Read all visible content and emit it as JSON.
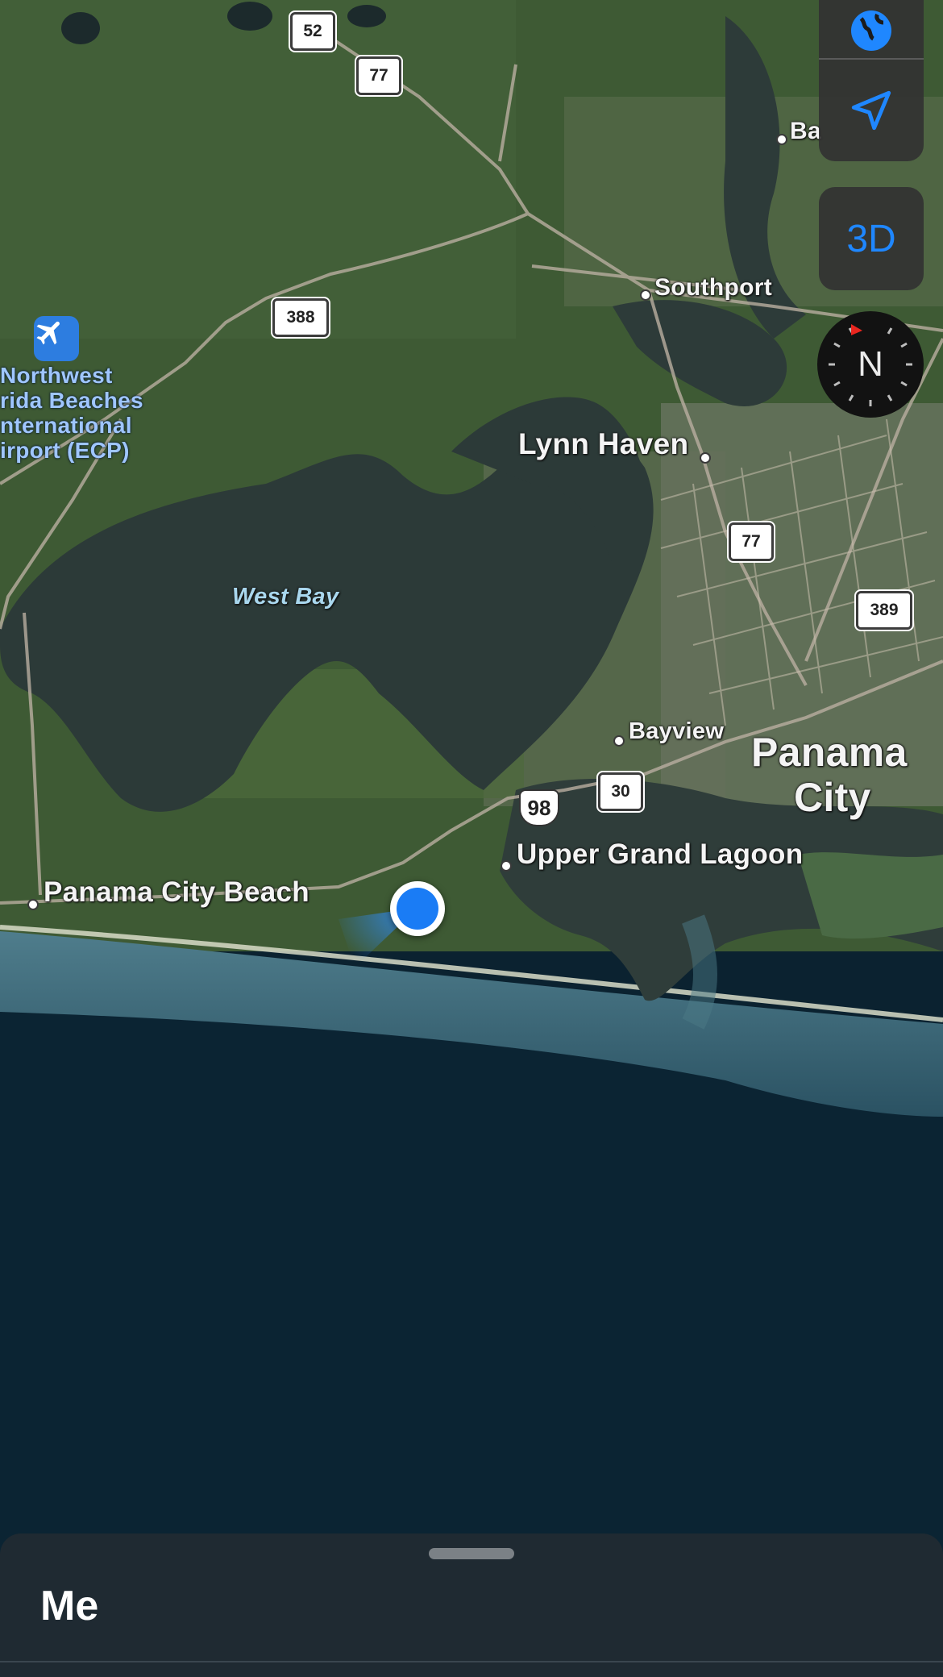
{
  "map": {
    "style": "satellite",
    "labels": {
      "southport": "Southport",
      "lynn_haven": "Lynn Haven",
      "west_bay": "West Bay",
      "bayview": "Bayview",
      "panama_city_line1": "Panama",
      "panama_city_line2": "City",
      "upper_grand_lagoon": "Upper Grand Lagoon",
      "panama_city_beach": "Panama City Beach",
      "bay_partial": "Ba",
      "airport_line1": "Northwest",
      "airport_line2": "rida Beaches",
      "airport_line3": "nternational",
      "airport_line4": "irport (ECP)"
    },
    "routes": {
      "r52": "52",
      "r77_north": "77",
      "r388": "388",
      "r77_east": "77",
      "r389": "389",
      "r30": "30",
      "us98": "98"
    },
    "icons": {
      "airport": "airplane-icon",
      "user_location": "current-location-dot"
    }
  },
  "controls": {
    "map_mode_icon": "globe-icon",
    "locate_icon": "location-arrow-icon",
    "view_3d_label": "3D",
    "compass_label": "N"
  },
  "sheet": {
    "title": "Me"
  },
  "colors": {
    "accent": "#1f87ff",
    "ocean": "#0b2230",
    "sheet_bg": "#1f2a32"
  }
}
